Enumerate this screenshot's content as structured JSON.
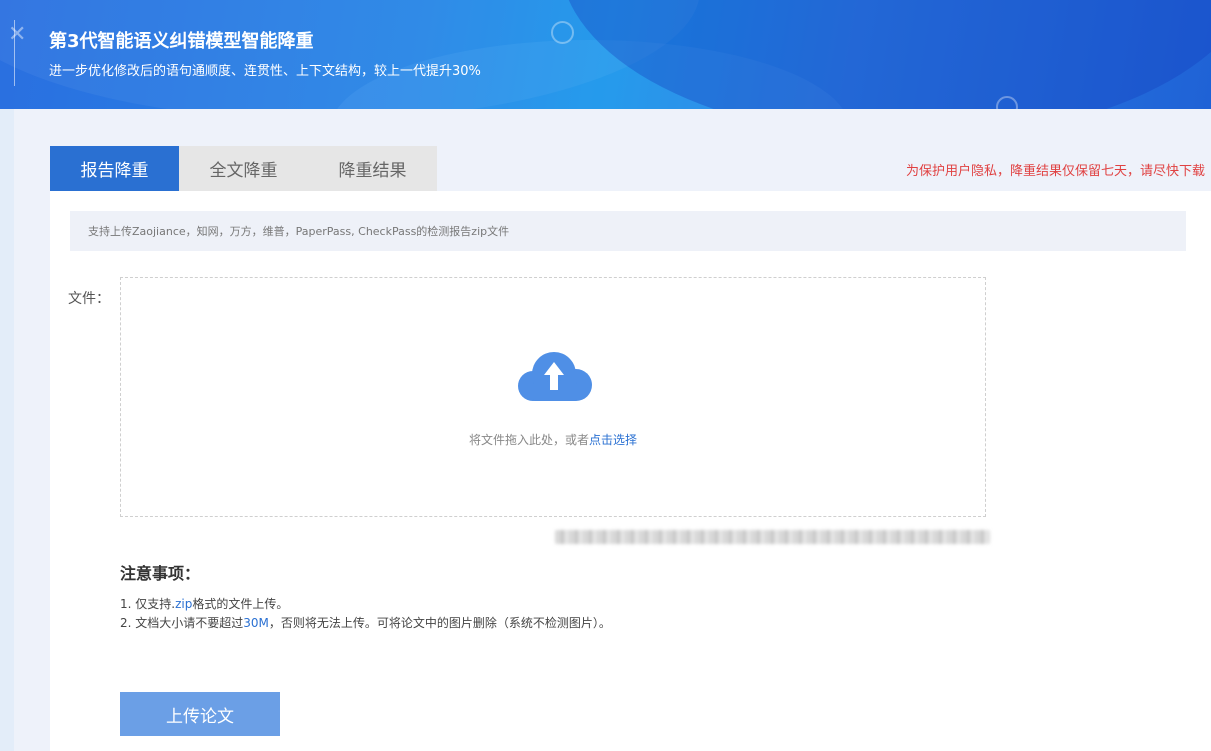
{
  "banner": {
    "title": "第3代智能语义纠错模型智能降重",
    "subtitle": "进一步优化修改后的语句通顺度、连贯性、上下文结构，较上一代提升30%"
  },
  "tabs": [
    {
      "label": "报告降重",
      "active": true
    },
    {
      "label": "全文降重",
      "active": false
    },
    {
      "label": "降重结果",
      "active": false
    }
  ],
  "privacy_note": "为保护用户隐私，降重结果仅保留七天，请尽快下载",
  "notice": "支持上传Zaojiance，知网，万方，维普，PaperPass, CheckPass的检测报告zip文件",
  "upload": {
    "file_label": "文件：",
    "drop_text": "将文件拖入此处，或者",
    "choose_link": "点击选择",
    "button_label": "上传论文"
  },
  "notes": {
    "title": "注意事项：",
    "item1_pre": "1. 仅支持.",
    "item1_hl": "zip",
    "item1_post": "格式的文件上传。",
    "item2_pre": "2. 文档大小请不要超过",
    "item2_hl": "30M",
    "item2_post": "，否则将无法上传。可将论文中的图片删除（系统不检测图片）。"
  },
  "colors": {
    "accent": "#2a70d2",
    "warning": "#e04141",
    "button": "#6b9fe6"
  },
  "icons": {
    "upload": "cloud-upload-icon"
  }
}
